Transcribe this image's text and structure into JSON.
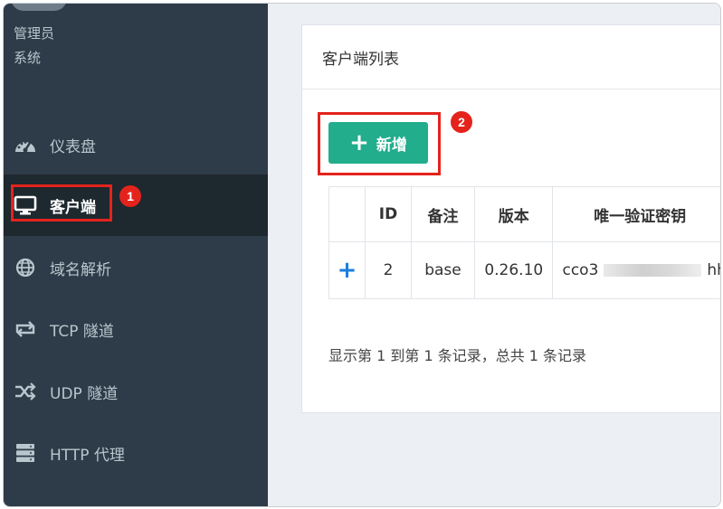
{
  "user": {
    "role": "管理员",
    "group": "系统"
  },
  "sidebar": {
    "items": [
      {
        "label": "仪表盘",
        "icon": "dashboard-icon"
      },
      {
        "label": "客户端",
        "icon": "monitor-icon",
        "active": true
      },
      {
        "label": "域名解析",
        "icon": "globe-icon"
      },
      {
        "label": "TCP 隧道",
        "icon": "exchange-icon"
      },
      {
        "label": "UDP 隧道",
        "icon": "shuffle-icon"
      },
      {
        "label": "HTTP 代理",
        "icon": "server-icon"
      }
    ]
  },
  "annotations": {
    "step1": "1",
    "step2": "2"
  },
  "panel": {
    "title": "客户端列表",
    "add_button": "新增",
    "table": {
      "columns": [
        "ID",
        "备注",
        "版本",
        "唯一验证密钥"
      ],
      "rows": [
        {
          "expand": "+",
          "id": "2",
          "remark": "base",
          "version": "0.26.10",
          "key_prefix": "cco3",
          "key_suffix": "hh"
        }
      ]
    },
    "footer": "显示第 1 到第 1 条记录，总共 1 条记录"
  },
  "colors": {
    "sidebar_bg": "#2e3b48",
    "active_bg": "#1e282f",
    "button": "#22ad8d",
    "annotation": "#e4231c",
    "expand": "#1a7fe0"
  }
}
